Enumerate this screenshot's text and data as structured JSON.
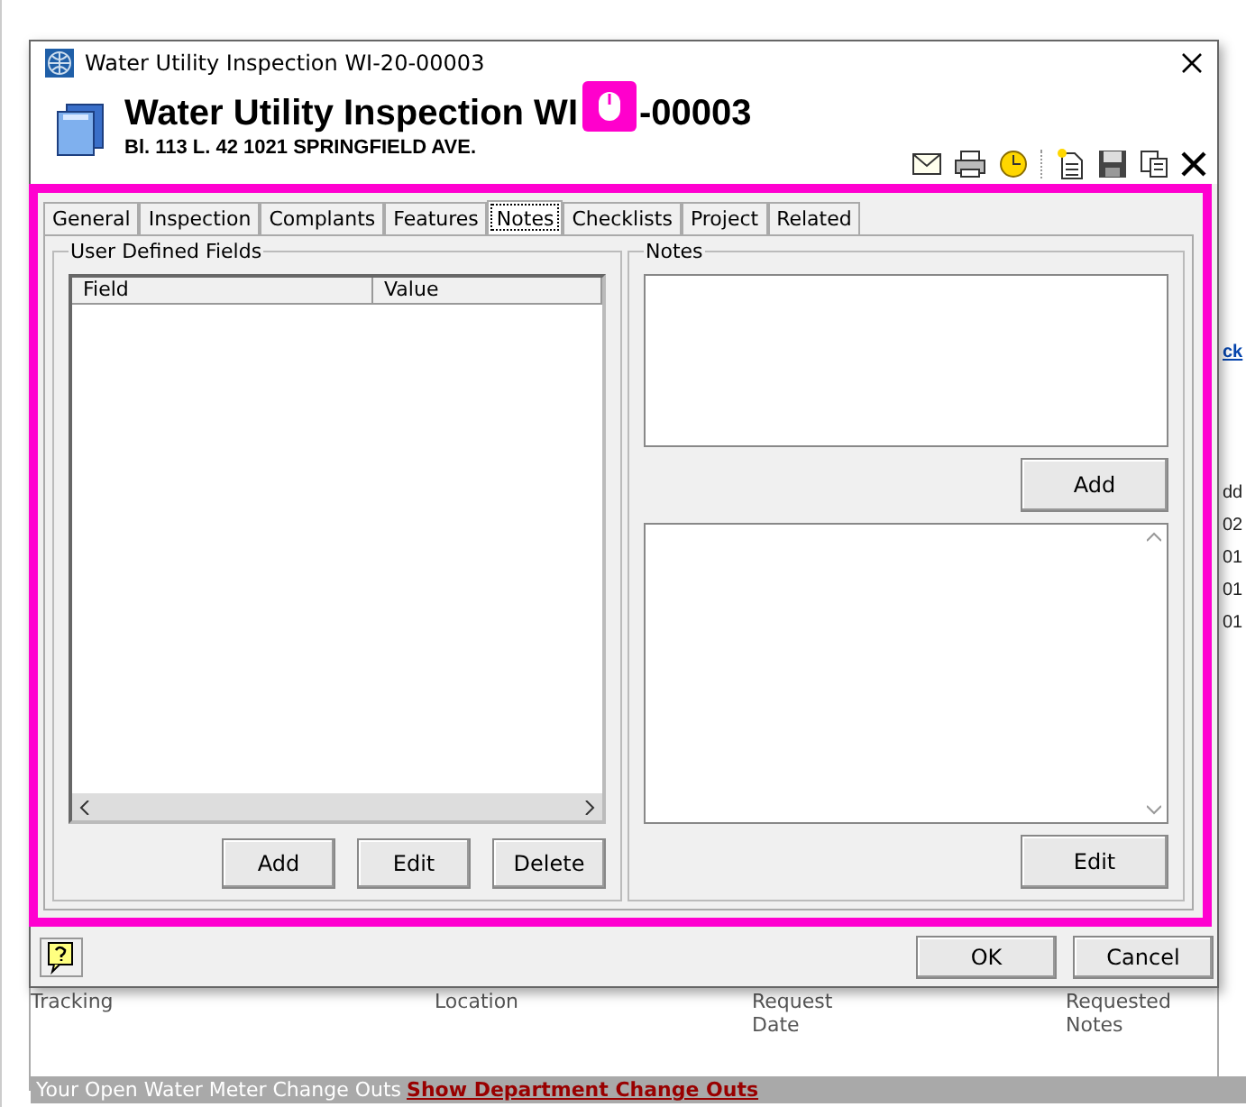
{
  "background": {
    "edge_texts": [
      {
        "text": "ck",
        "kind": "link"
      },
      {
        "text": "dd",
        "kind": "plain"
      },
      {
        "text": "02",
        "kind": "plain"
      },
      {
        "text": "01",
        "kind": "plain"
      },
      {
        "text": "01",
        "kind": "plain"
      },
      {
        "text": "01",
        "kind": "plain"
      }
    ],
    "columns": [
      "Tracking",
      "Location",
      "Request Date",
      "Requested Notes"
    ],
    "bar": {
      "text": "Your Open Water Meter Change Outs",
      "link": "Show Department Change Outs"
    }
  },
  "window": {
    "title": "Water Utility Inspection WI-20-00003",
    "heading_start": "Water Utility Inspection WI",
    "heading_end": "-00003",
    "address": "Bl. 113 L. 42  1021 SPRINGFIELD AVE.",
    "tabs": [
      {
        "label": "General",
        "selected": false
      },
      {
        "label": "Inspection",
        "selected": false
      },
      {
        "label": "Complants",
        "selected": false
      },
      {
        "label": "Features",
        "selected": false
      },
      {
        "label": "Notes",
        "selected": true
      },
      {
        "label": "Checklists",
        "selected": false
      },
      {
        "label": "Project",
        "selected": false
      },
      {
        "label": "Related",
        "selected": false
      }
    ],
    "udf": {
      "title": "User Defined Fields",
      "columns": [
        "Field",
        "Value"
      ],
      "buttons": [
        "Add",
        "Edit",
        "Delete"
      ]
    },
    "notes": {
      "title": "Notes",
      "add_button": "Add",
      "edit_button": "Edit"
    },
    "buttons": [
      "OK",
      "Cancel"
    ]
  }
}
